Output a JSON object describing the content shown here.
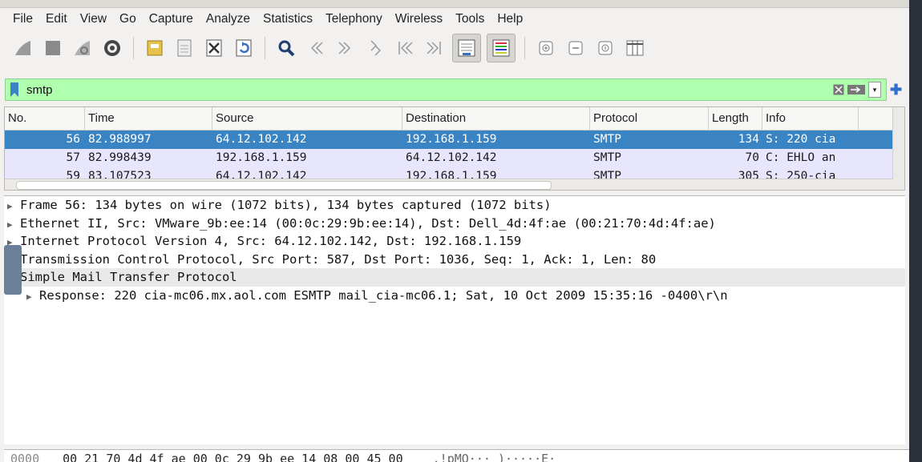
{
  "menubar": {
    "items": [
      "File",
      "Edit",
      "View",
      "Go",
      "Capture",
      "Analyze",
      "Statistics",
      "Telephony",
      "Wireless",
      "Tools",
      "Help"
    ]
  },
  "toolbar": {
    "icons": [
      "shark-fin-start-icon",
      "stop-icon",
      "restart-icon",
      "capture-options-icon",
      "open-file-icon",
      "save-file-icon",
      "close-file-icon",
      "reload-icon",
      "search-icon",
      "go-back-icon",
      "go-forward-icon",
      "go-to-packet-icon",
      "first-packet-icon",
      "last-packet-icon",
      "autoscroll-icon",
      "colorize-icon",
      "zoom-in-icon",
      "zoom-out-icon",
      "normal-size-icon",
      "resize-columns-icon"
    ]
  },
  "filter": {
    "value": "smtp",
    "bg_color": "#afffaf"
  },
  "packet_list": {
    "columns": [
      "No.",
      "Time",
      "Source",
      "Destination",
      "Protocol",
      "Length",
      "Info"
    ],
    "rows": [
      {
        "no": "56",
        "time": "82.988997",
        "source": "64.12.102.142",
        "destination": "192.168.1.159",
        "protocol": "SMTP",
        "length": "134",
        "info": "S: 220 cia"
      },
      {
        "no": "57",
        "time": "82.998439",
        "source": "192.168.1.159",
        "destination": "64.12.102.142",
        "protocol": "SMTP",
        "length": "70",
        "info": "C: EHLO an"
      },
      {
        "no": "59",
        "time": "83.107523",
        "source": "64.12.102.142",
        "destination": "192.168.1.159",
        "protocol": "SMTP",
        "length": "305",
        "info": "S: 250-cia"
      }
    ],
    "selected_color": "#3a84c3",
    "smtp_color": "#e8e6fc"
  },
  "details": {
    "lines": [
      "Frame 56: 134 bytes on wire (1072 bits), 134 bytes captured (1072 bits)",
      "Ethernet II, Src: VMware_9b:ee:14 (00:0c:29:9b:ee:14), Dst: Dell_4d:4f:ae (00:21:70:4d:4f:ae)",
      "Internet Protocol Version 4, Src: 64.12.102.142, Dst: 192.168.1.159",
      "Transmission Control Protocol, Src Port: 587, Dst Port: 1036, Seq: 1, Ack: 1, Len: 80",
      "Simple Mail Transfer Protocol",
      "Response: 220 cia-mc06.mx.aol.com ESMTP mail_cia-mc06.1; Sat, 10 Oct 2009 15:35:16 -0400\\r\\n"
    ]
  },
  "bytes": {
    "offset": "0000",
    "hex": "00 21 70 4d 4f ae 00 0c  29 9b ee 14 08 00 45 00",
    "ascii": ".!pMO··· )·····E·"
  }
}
